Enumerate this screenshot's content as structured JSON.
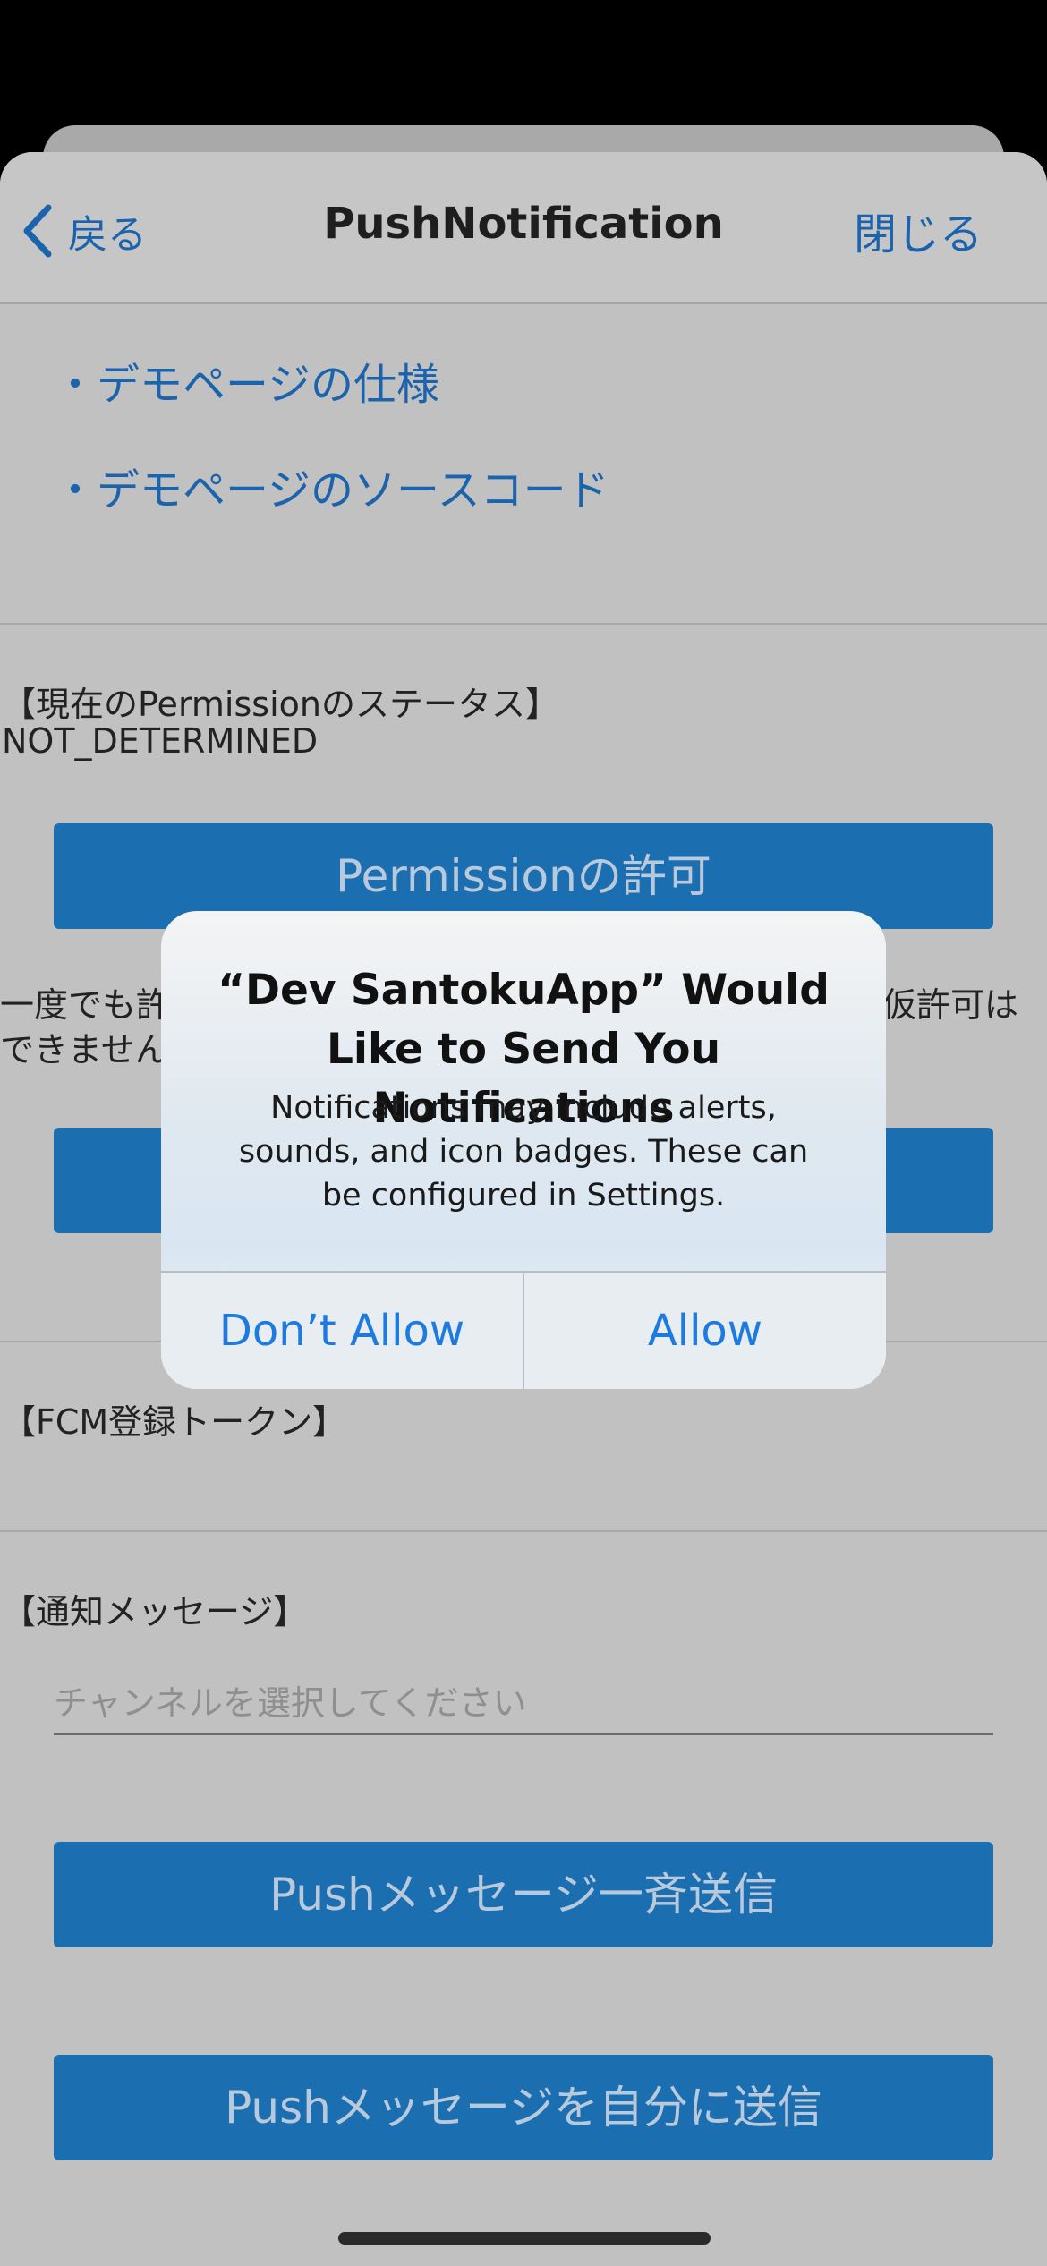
{
  "navbar": {
    "back_label": "戻る",
    "title": "PushNotification",
    "close_label": "閉じる"
  },
  "links": [
    "・デモページの仕様",
    "・デモページのソースコード"
  ],
  "permission": {
    "status_header": "【現在のPermissionのステータス】",
    "status_value": "NOT_DETERMINED",
    "request_button": "Permissionの許可",
    "note_left_line1": "一度でも許",
    "note_left_line2": "できません",
    "note_right": "仮許可は"
  },
  "fcm": {
    "header": "【FCM登録トークン】"
  },
  "notification": {
    "header": "【通知メッセージ】",
    "channel_placeholder": "チャンネルを選択してください",
    "broadcast_button": "Pushメッセージ一斉送信",
    "self_button": "Pushメッセージを自分に送信"
  },
  "alert": {
    "title_line1": "“Dev SantokuApp” Would",
    "title_line2": "Like to Send You Notifications",
    "message_line1": "Notifications may include alerts,",
    "message_line2": "sounds, and icon badges. These can",
    "message_line3": "be configured in Settings.",
    "deny_label": "Don’t Allow",
    "allow_label": "Allow"
  },
  "colors": {
    "accent": "#1b63ac",
    "button_bg": "#1b6eb0",
    "alert_action": "#1c7ae0"
  }
}
